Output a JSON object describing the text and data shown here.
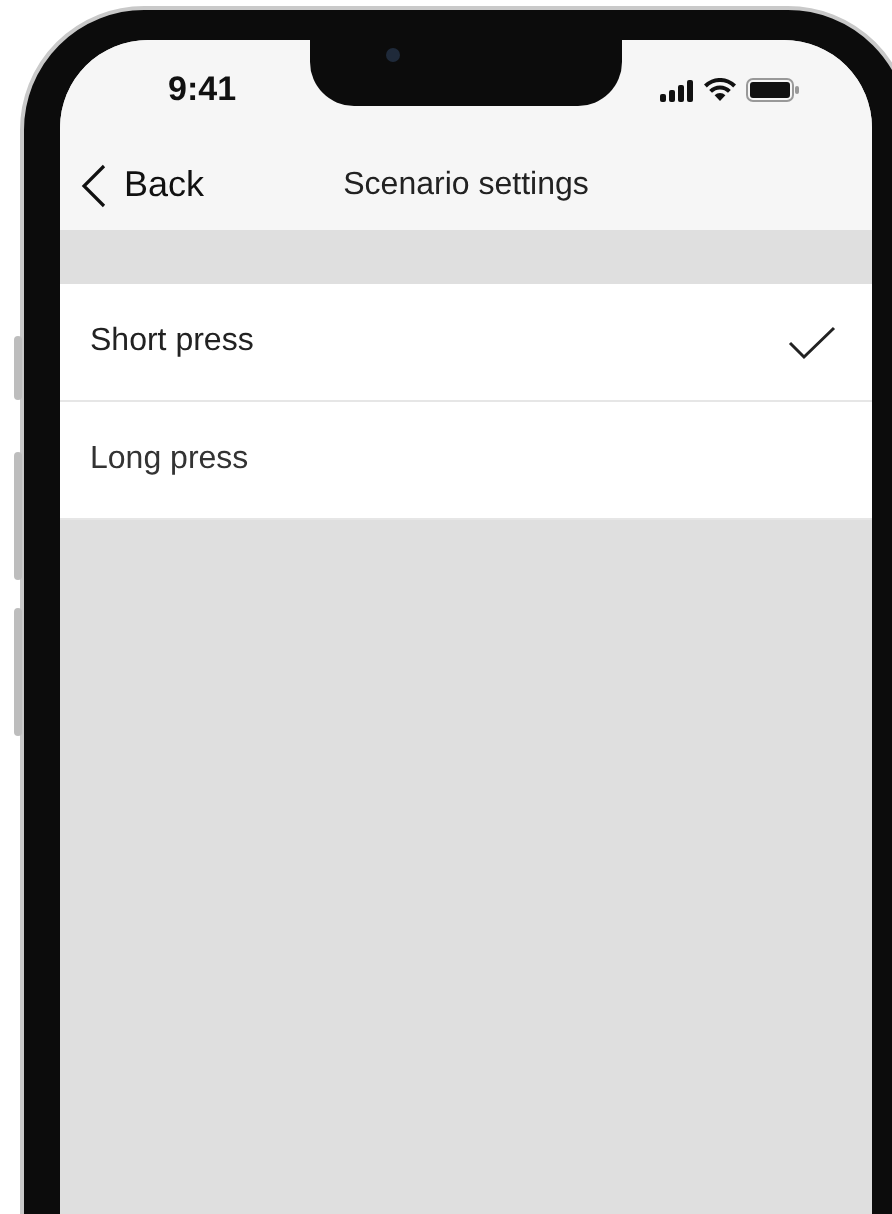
{
  "status_bar": {
    "time": "9:41"
  },
  "nav": {
    "back_label": "Back",
    "title": "Scenario settings"
  },
  "options": [
    {
      "label": "Short press",
      "selected": true
    },
    {
      "label": "Long press",
      "selected": false
    }
  ]
}
